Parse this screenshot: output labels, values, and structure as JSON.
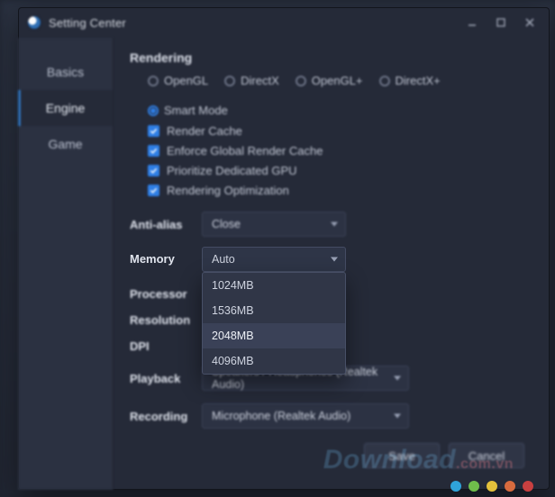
{
  "window": {
    "title": "Setting Center"
  },
  "sidebar": {
    "tabs": [
      {
        "label": "Basics",
        "active": false
      },
      {
        "label": "Engine",
        "active": true
      },
      {
        "label": "Game",
        "active": false
      }
    ]
  },
  "rendering": {
    "heading": "Rendering",
    "modes": [
      {
        "label": "OpenGL",
        "selected": false
      },
      {
        "label": "DirectX",
        "selected": false
      },
      {
        "label": "OpenGL+",
        "selected": false
      },
      {
        "label": "DirectX+",
        "selected": false
      },
      {
        "label": "Smart Mode",
        "selected": true
      }
    ],
    "checks": [
      {
        "label": "Render Cache",
        "checked": true
      },
      {
        "label": "Enforce Global Render Cache",
        "checked": true
      },
      {
        "label": "Prioritize Dedicated GPU",
        "checked": true
      },
      {
        "label": "Rendering Optimization",
        "checked": true
      }
    ]
  },
  "fields": {
    "anti_alias": {
      "label": "Anti-alias",
      "value": "Close"
    },
    "memory": {
      "label": "Memory",
      "value": "Auto",
      "options": [
        "1024MB",
        "1536MB",
        "2048MB",
        "4096MB"
      ],
      "hovered_index": 2
    },
    "processor": {
      "label": "Processor",
      "value": ""
    },
    "resolution": {
      "label": "Resolution",
      "value": ""
    },
    "dpi": {
      "label": "DPI",
      "value": ""
    },
    "playback": {
      "label": "Playback",
      "value": "Speakers / Headphones (Realtek Audio)"
    },
    "recording": {
      "label": "Recording",
      "value": "Microphone (Realtek Audio)"
    }
  },
  "footer": {
    "save": "Save",
    "cancel": "Cancel"
  },
  "watermark": {
    "brand": "Download",
    "ext": ".com.vn"
  }
}
